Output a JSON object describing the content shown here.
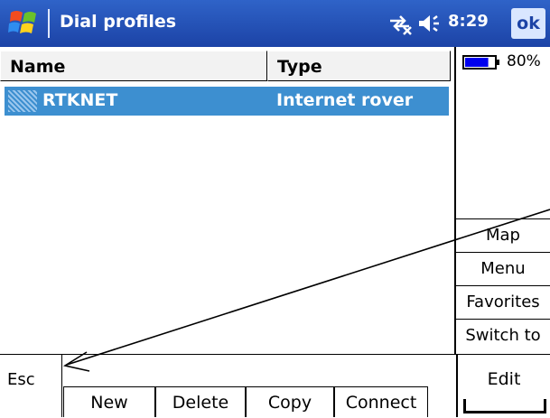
{
  "titlebar": {
    "title": "Dial profiles",
    "time": "8:29",
    "ok_label": "ok"
  },
  "battery": {
    "percent_text": "80%",
    "level": 0.8
  },
  "table": {
    "columns": [
      "Name",
      "Type"
    ],
    "rows": [
      {
        "name": "RTKNET",
        "type": "Internet rover",
        "selected": true
      }
    ]
  },
  "side_menu": [
    "Map",
    "Menu",
    "Favorites",
    "Switch to"
  ],
  "bottom": {
    "esc": "Esc",
    "buttons": [
      "New",
      "Delete",
      "Copy",
      "Connect"
    ],
    "edit": "Edit"
  },
  "colors": {
    "titlebar": "#1c43a6",
    "selection": "#3d8fd0"
  }
}
